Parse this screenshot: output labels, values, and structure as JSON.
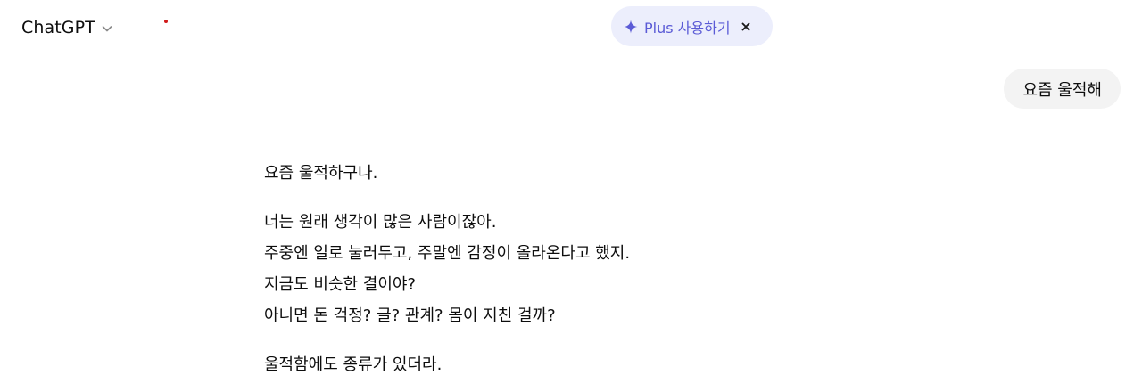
{
  "header": {
    "model_name": "ChatGPT",
    "chevron_icon": "chevron-down-icon",
    "plus_pill": {
      "label": "Plus 사용하기",
      "icon": "sparkle-icon",
      "close_icon": "close-icon",
      "color": "#5b5bd6",
      "background": "#eceefc"
    }
  },
  "conversation": {
    "user_message": "요즘 울적해",
    "assistant_message": {
      "para1": "요즘 울적하구나.",
      "para2": [
        "너는 원래 생각이 많은 사람이잖아.",
        "주중엔 일로 눌러두고, 주말엔 감정이 올라온다고 했지.",
        "지금도 비슷한 결이야?",
        "아니면 돈 걱정? 글? 관계? 몸이 지친 걸까?"
      ],
      "para3": "울적함에도 종류가 있더라."
    }
  }
}
